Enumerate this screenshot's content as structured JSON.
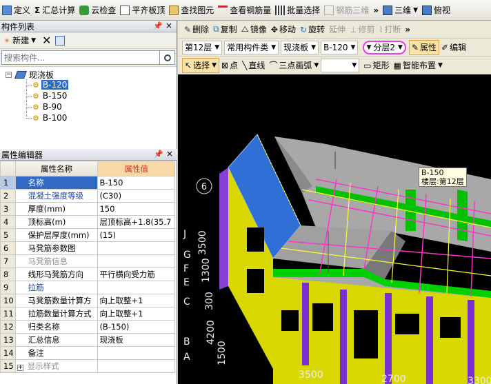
{
  "toolbar": {
    "items": [
      "定义",
      "汇总计算",
      "云检查",
      "平齐板顶",
      "查找图元",
      "查看钢筋量",
      "批量选择",
      "钢筋三维",
      "三维",
      "俯视"
    ],
    "more": "»"
  },
  "component_list": {
    "title": "构件列表",
    "new_label": "新建",
    "search_placeholder": "搜索构件...",
    "root": "现浇板",
    "items": [
      "B-120",
      "B-150",
      "B-90",
      "B-100"
    ],
    "selected": "B-120"
  },
  "property_editor": {
    "title": "属性编辑器",
    "col_name": "属性名称",
    "col_value": "属性值",
    "rows": [
      {
        "n": "1",
        "k": "名称",
        "v": "B-150"
      },
      {
        "n": "2",
        "k": "混凝土强度等级",
        "v": "(C30)"
      },
      {
        "n": "3",
        "k": "厚度(mm)",
        "v": "150"
      },
      {
        "n": "4",
        "k": "顶标高(m)",
        "v": "层顶标高+1.8(35.7"
      },
      {
        "n": "5",
        "k": "保护层厚度(mm)",
        "v": "(15)"
      },
      {
        "n": "6",
        "k": "马凳筋参数图",
        "v": ""
      },
      {
        "n": "7",
        "k": "马凳筋信息",
        "v": ""
      },
      {
        "n": "8",
        "k": "线形马凳筋方向",
        "v": "平行横向受力筋"
      },
      {
        "n": "9",
        "k": "拉筋",
        "v": ""
      },
      {
        "n": "10",
        "k": "马凳筋数量计算方",
        "v": "向上取整+1"
      },
      {
        "n": "11",
        "k": "拉筋数量计算方式",
        "v": "向上取整+1"
      },
      {
        "n": "12",
        "k": "归类名称",
        "v": "(B-150)"
      },
      {
        "n": "13",
        "k": "汇总信息",
        "v": "现浇板"
      },
      {
        "n": "14",
        "k": "备注",
        "v": ""
      },
      {
        "n": "15",
        "k": "显示样式",
        "v": ""
      }
    ]
  },
  "edit_toolbar": {
    "delete": "删除",
    "copy": "复制",
    "mirror": "镜像",
    "move": "移动",
    "rotate": "旋转",
    "extend": "延伸",
    "trim": "修剪",
    "break": "打断",
    "more": "»"
  },
  "selectors": {
    "floor": "第12层",
    "category": "常用构件类",
    "type": "现浇板",
    "component": "B-120",
    "layer": "分层2",
    "properties": "属性",
    "edit": "编辑"
  },
  "draw_toolbar": {
    "select": "选择",
    "point": "点",
    "line": "直线",
    "arc": "三点画弧",
    "rect": "矩形",
    "smart": "智能布置"
  },
  "tooltip": {
    "line1": "B-150",
    "line2": "楼层:第12层"
  },
  "axes": {
    "circle_top": "6",
    "left_labels": [
      "J",
      "G",
      "F",
      "E",
      "C",
      "B",
      "A"
    ],
    "dims": [
      "3500",
      "1300",
      "300",
      "4200",
      "1500",
      "3500",
      "2700",
      "3300"
    ]
  }
}
